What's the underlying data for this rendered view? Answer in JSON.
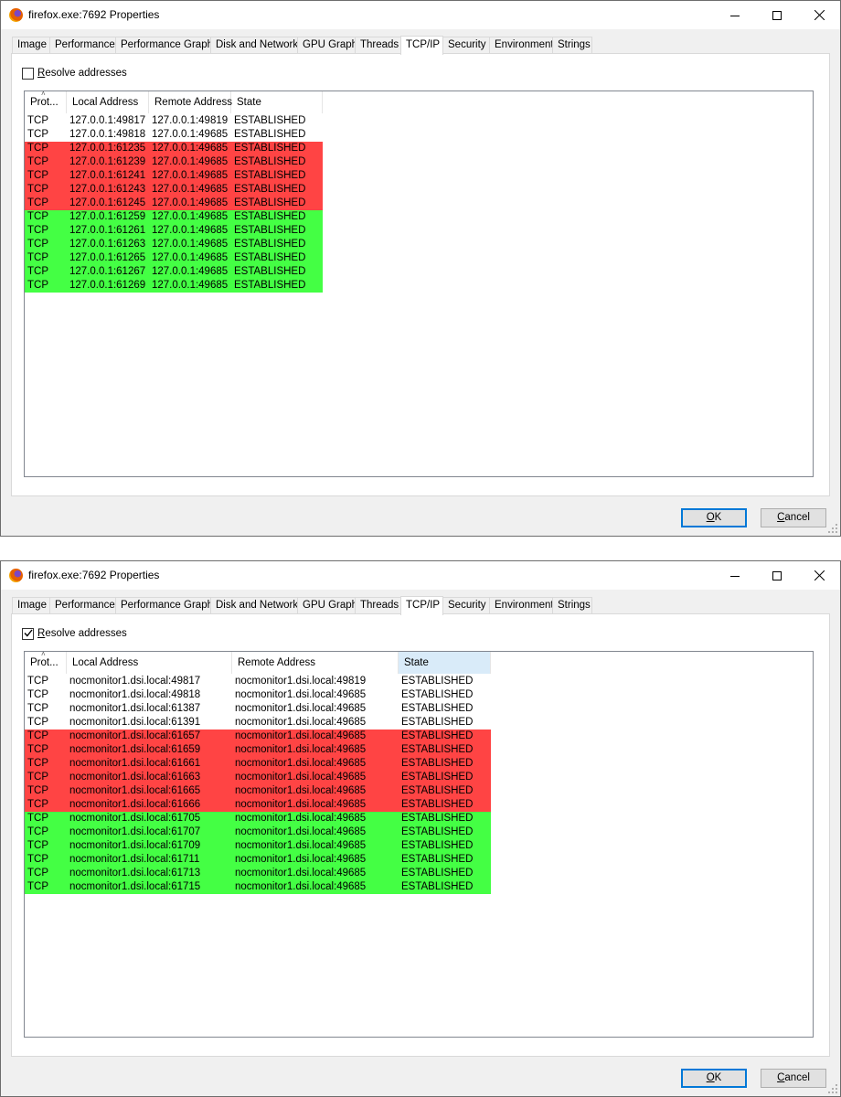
{
  "colors": {
    "row_red": "#ff4444",
    "row_green": "#44ff44",
    "header_highlight": "#d9ebf9",
    "default_button_border": "#0078d7"
  },
  "windows": [
    {
      "title": "firefox.exe:7692 Properties",
      "tabs": [
        "Image",
        "Performance",
        "Performance Graph",
        "Disk and Network",
        "GPU Graph",
        "Threads",
        "TCP/IP",
        "Security",
        "Environment",
        "Strings"
      ],
      "active_tab": "TCP/IP",
      "resolve_prefix": "",
      "resolve_accel": "R",
      "resolve_rest": "esolve addresses",
      "resolve_checked": false,
      "columns": [
        "Prot...",
        "Local Address",
        "Remote Address",
        "State"
      ],
      "rows": [
        {
          "protocol": "TCP",
          "local": "127.0.0.1:49817",
          "remote": "127.0.0.1:49819",
          "state": "ESTABLISHED",
          "highlight": "none"
        },
        {
          "protocol": "TCP",
          "local": "127.0.0.1:49818",
          "remote": "127.0.0.1:49685",
          "state": "ESTABLISHED",
          "highlight": "none"
        },
        {
          "protocol": "TCP",
          "local": "127.0.0.1:61235",
          "remote": "127.0.0.1:49685",
          "state": "ESTABLISHED",
          "highlight": "red"
        },
        {
          "protocol": "TCP",
          "local": "127.0.0.1:61239",
          "remote": "127.0.0.1:49685",
          "state": "ESTABLISHED",
          "highlight": "red"
        },
        {
          "protocol": "TCP",
          "local": "127.0.0.1:61241",
          "remote": "127.0.0.1:49685",
          "state": "ESTABLISHED",
          "highlight": "red"
        },
        {
          "protocol": "TCP",
          "local": "127.0.0.1:61243",
          "remote": "127.0.0.1:49685",
          "state": "ESTABLISHED",
          "highlight": "red"
        },
        {
          "protocol": "TCP",
          "local": "127.0.0.1:61245",
          "remote": "127.0.0.1:49685",
          "state": "ESTABLISHED",
          "highlight": "red"
        },
        {
          "protocol": "TCP",
          "local": "127.0.0.1:61259",
          "remote": "127.0.0.1:49685",
          "state": "ESTABLISHED",
          "highlight": "green"
        },
        {
          "protocol": "TCP",
          "local": "127.0.0.1:61261",
          "remote": "127.0.0.1:49685",
          "state": "ESTABLISHED",
          "highlight": "green"
        },
        {
          "protocol": "TCP",
          "local": "127.0.0.1:61263",
          "remote": "127.0.0.1:49685",
          "state": "ESTABLISHED",
          "highlight": "green"
        },
        {
          "protocol": "TCP",
          "local": "127.0.0.1:61265",
          "remote": "127.0.0.1:49685",
          "state": "ESTABLISHED",
          "highlight": "green"
        },
        {
          "protocol": "TCP",
          "local": "127.0.0.1:61267",
          "remote": "127.0.0.1:49685",
          "state": "ESTABLISHED",
          "highlight": "green"
        },
        {
          "protocol": "TCP",
          "local": "127.0.0.1:61269",
          "remote": "127.0.0.1:49685",
          "state": "ESTABLISHED",
          "highlight": "green"
        }
      ],
      "ok_accel": "O",
      "ok_rest": "K",
      "cancel_accel": "C",
      "cancel_rest": "ancel",
      "icons": [
        "firefox-icon",
        "minimize-icon",
        "maximize-icon",
        "close-icon",
        "resize-grip-icon"
      ]
    },
    {
      "title": "firefox.exe:7692 Properties",
      "tabs": [
        "Image",
        "Performance",
        "Performance Graph",
        "Disk and Network",
        "GPU Graph",
        "Threads",
        "TCP/IP",
        "Security",
        "Environment",
        "Strings"
      ],
      "active_tab": "TCP/IP",
      "resolve_prefix": "",
      "resolve_accel": "R",
      "resolve_rest": "esolve addresses",
      "resolve_checked": true,
      "columns": [
        "Prot...",
        "Local Address",
        "Remote Address",
        "State"
      ],
      "rows": [
        {
          "protocol": "TCP",
          "local": "nocmonitor1.dsi.local:49817",
          "remote": "nocmonitor1.dsi.local:49819",
          "state": "ESTABLISHED",
          "highlight": "none"
        },
        {
          "protocol": "TCP",
          "local": "nocmonitor1.dsi.local:49818",
          "remote": "nocmonitor1.dsi.local:49685",
          "state": "ESTABLISHED",
          "highlight": "none"
        },
        {
          "protocol": "TCP",
          "local": "nocmonitor1.dsi.local:61387",
          "remote": "nocmonitor1.dsi.local:49685",
          "state": "ESTABLISHED",
          "highlight": "none"
        },
        {
          "protocol": "TCP",
          "local": "nocmonitor1.dsi.local:61391",
          "remote": "nocmonitor1.dsi.local:49685",
          "state": "ESTABLISHED",
          "highlight": "none"
        },
        {
          "protocol": "TCP",
          "local": "nocmonitor1.dsi.local:61657",
          "remote": "nocmonitor1.dsi.local:49685",
          "state": "ESTABLISHED",
          "highlight": "red"
        },
        {
          "protocol": "TCP",
          "local": "nocmonitor1.dsi.local:61659",
          "remote": "nocmonitor1.dsi.local:49685",
          "state": "ESTABLISHED",
          "highlight": "red"
        },
        {
          "protocol": "TCP",
          "local": "nocmonitor1.dsi.local:61661",
          "remote": "nocmonitor1.dsi.local:49685",
          "state": "ESTABLISHED",
          "highlight": "red"
        },
        {
          "protocol": "TCP",
          "local": "nocmonitor1.dsi.local:61663",
          "remote": "nocmonitor1.dsi.local:49685",
          "state": "ESTABLISHED",
          "highlight": "red"
        },
        {
          "protocol": "TCP",
          "local": "nocmonitor1.dsi.local:61665",
          "remote": "nocmonitor1.dsi.local:49685",
          "state": "ESTABLISHED",
          "highlight": "red"
        },
        {
          "protocol": "TCP",
          "local": "nocmonitor1.dsi.local:61666",
          "remote": "nocmonitor1.dsi.local:49685",
          "state": "ESTABLISHED",
          "highlight": "red"
        },
        {
          "protocol": "TCP",
          "local": "nocmonitor1.dsi.local:61705",
          "remote": "nocmonitor1.dsi.local:49685",
          "state": "ESTABLISHED",
          "highlight": "green"
        },
        {
          "protocol": "TCP",
          "local": "nocmonitor1.dsi.local:61707",
          "remote": "nocmonitor1.dsi.local:49685",
          "state": "ESTABLISHED",
          "highlight": "green"
        },
        {
          "protocol": "TCP",
          "local": "nocmonitor1.dsi.local:61709",
          "remote": "nocmonitor1.dsi.local:49685",
          "state": "ESTABLISHED",
          "highlight": "green"
        },
        {
          "protocol": "TCP",
          "local": "nocmonitor1.dsi.local:61711",
          "remote": "nocmonitor1.dsi.local:49685",
          "state": "ESTABLISHED",
          "highlight": "green"
        },
        {
          "protocol": "TCP",
          "local": "nocmonitor1.dsi.local:61713",
          "remote": "nocmonitor1.dsi.local:49685",
          "state": "ESTABLISHED",
          "highlight": "green"
        },
        {
          "protocol": "TCP",
          "local": "nocmonitor1.dsi.local:61715",
          "remote": "nocmonitor1.dsi.local:49685",
          "state": "ESTABLISHED",
          "highlight": "green"
        }
      ],
      "ok_accel": "O",
      "ok_rest": "K",
      "cancel_accel": "C",
      "cancel_rest": "ancel",
      "icons": [
        "firefox-icon",
        "minimize-icon",
        "maximize-icon",
        "close-icon",
        "resize-grip-icon"
      ]
    }
  ]
}
